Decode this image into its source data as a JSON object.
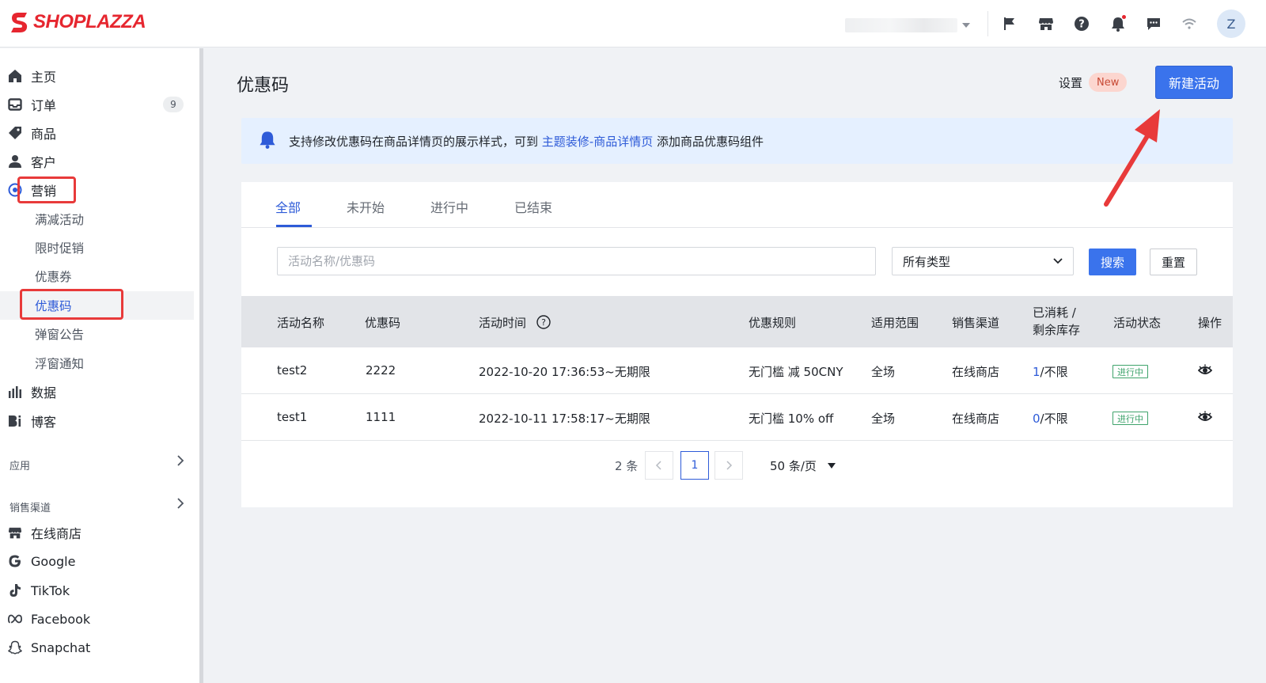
{
  "brand": {
    "logo_text": "SHOPLAZZA",
    "red": "#e6262f"
  },
  "header": {
    "icons": [
      "flag-icon",
      "store-icon",
      "help-icon",
      "bell-icon",
      "message-icon",
      "wifi-icon"
    ],
    "avatar_initial": "Z"
  },
  "sidebar": {
    "items": [
      {
        "label": "主页",
        "icon": "home-icon"
      },
      {
        "label": "订单",
        "icon": "inbox-icon",
        "badge": "9"
      },
      {
        "label": "商品",
        "icon": "tag-icon"
      },
      {
        "label": "客户",
        "icon": "user-icon"
      },
      {
        "label": "营销",
        "icon": "target-icon"
      }
    ],
    "marketing_sub": [
      {
        "label": "满减活动"
      },
      {
        "label": "限时促销"
      },
      {
        "label": "优惠券"
      },
      {
        "label": "优惠码",
        "active": true
      },
      {
        "label": "弹窗公告"
      },
      {
        "label": "浮窗通知"
      }
    ],
    "items2": [
      {
        "label": "数据",
        "icon": "bar-chart-icon"
      },
      {
        "label": "博客",
        "icon": "blog-icon"
      }
    ],
    "apps_section": "应用",
    "channels_section": "销售渠道",
    "channels": [
      {
        "label": "在线商店",
        "icon": "store-icon"
      },
      {
        "label": "Google",
        "icon": "google-icon"
      },
      {
        "label": "TikTok",
        "icon": "tiktok-icon"
      },
      {
        "label": "Facebook",
        "icon": "meta-icon"
      },
      {
        "label": "Snapchat",
        "icon": "snapchat-icon"
      }
    ]
  },
  "page": {
    "title": "优惠码",
    "settings_label": "设置",
    "new_badge": "New",
    "create_button": "新建活动"
  },
  "notice": {
    "text_before": "支持修改优惠码在商品详情页的展示样式，可到 ",
    "link": "主题装修-商品详情页",
    "text_after": " 添加商品优惠码组件"
  },
  "tabs": [
    "全部",
    "未开始",
    "进行中",
    "已结束"
  ],
  "filters": {
    "search_placeholder": "活动名称/优惠码",
    "type_value": "所有类型",
    "search_button": "搜索",
    "reset_button": "重置"
  },
  "table": {
    "headers": {
      "name": "活动名称",
      "code": "优惠码",
      "time": "活动时间",
      "rule": "优惠规则",
      "scope": "适用范围",
      "channel": "销售渠道",
      "stock_line1": "已消耗 /",
      "stock_line2": "剩余库存",
      "status": "活动状态",
      "ops": "操作"
    },
    "rows": [
      {
        "name": "test2",
        "code": "2222",
        "time": "2022-10-20 17:36:53~无期限",
        "rule": "无门槛 减 50CNY",
        "scope": "全场",
        "channel": "在线商店",
        "used": "1",
        "remain": "/不限",
        "status": "进行中"
      },
      {
        "name": "test1",
        "code": "1111",
        "time": "2022-10-11 17:58:17~无期限",
        "rule": "无门槛 10% off",
        "scope": "全场",
        "channel": "在线商店",
        "used": "0",
        "remain": "/不限",
        "status": "进行中"
      }
    ]
  },
  "pagination": {
    "total": "2 条",
    "current": "1",
    "page_size": "50 条/页"
  },
  "colors": {
    "primary": "#3a73ec",
    "link": "#2e5bd8",
    "status_green": "#3ea36b",
    "annotation_red": "#e83a3a"
  }
}
